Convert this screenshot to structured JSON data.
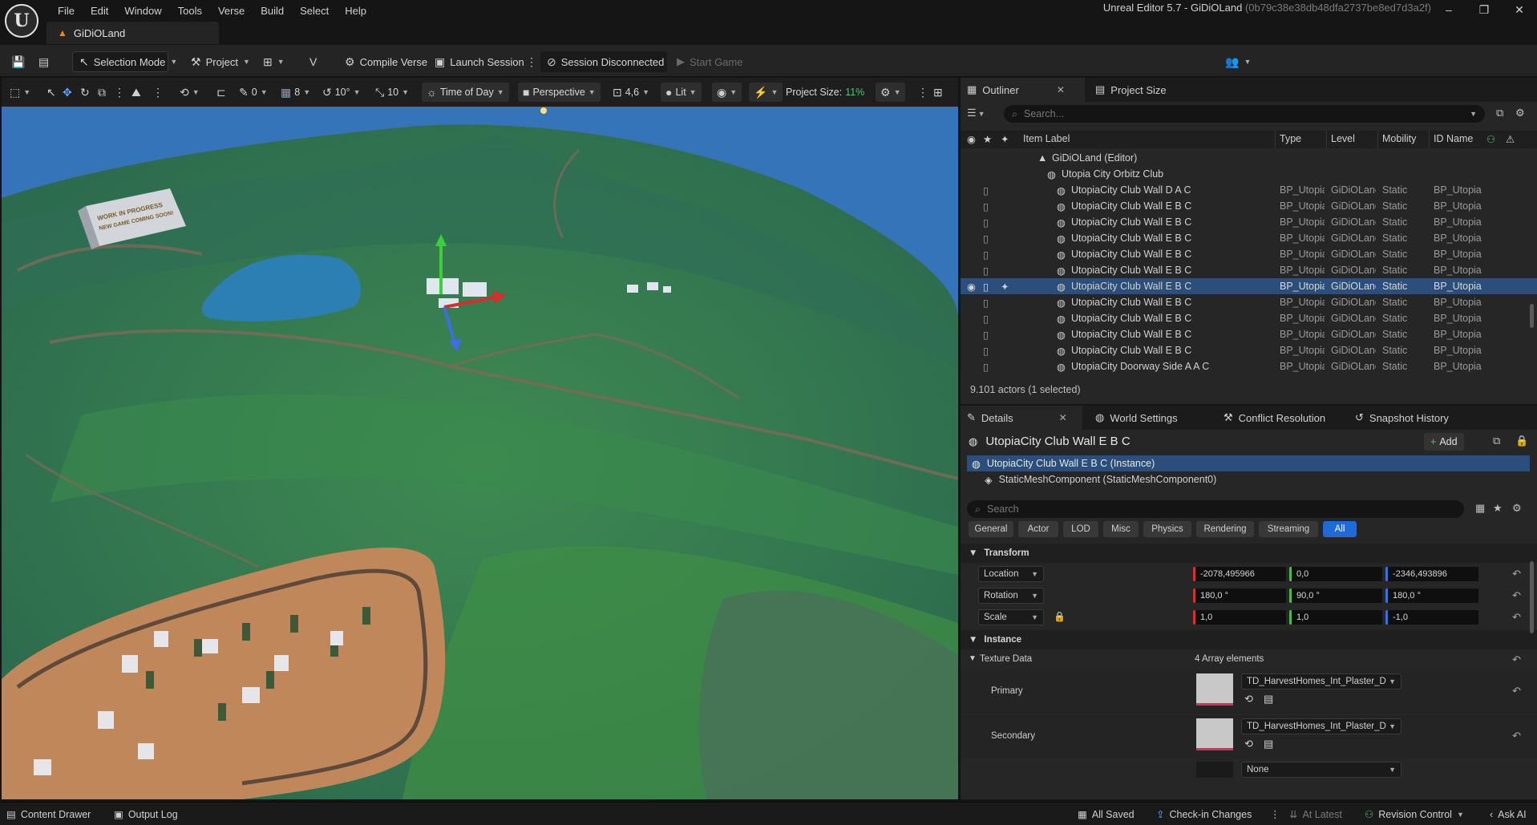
{
  "app": {
    "window_title": "Unreal Editor 5.7 - GiDiOLand",
    "window_hash": "(0b79c38e38db48dfa2737be8ed7d3a2f)",
    "project_tab": "GiDiOLand",
    "logo_glyph": "U",
    "window_controls": [
      "–",
      "❐",
      "✕"
    ]
  },
  "menu": [
    "File",
    "Edit",
    "Window",
    "Tools",
    "Verse",
    "Build",
    "Select",
    "Help"
  ],
  "toolbar": {
    "selection_mode": "Selection Mode",
    "project": "Project",
    "compile_verse": "Compile Verse",
    "launch_session": "Launch Session",
    "session_status": "Session Disconnected",
    "start_game": "Start Game"
  },
  "viewport_toolbar": {
    "rotation_snap_translate": "0",
    "grid_snap": "8",
    "rotation_snap": "10°",
    "scale_snap": "10",
    "time_of_day": "Time of Day",
    "perspective": "Perspective",
    "camera_speed": "4,6",
    "view_mode": "Lit",
    "project_size_label": "Project Size:",
    "project_size_value": "11%"
  },
  "viewport": {
    "sign_line1": "WORK IN PROGRESS",
    "sign_line2": "NEW GAME COMING SOON!"
  },
  "outliner": {
    "tab_outliner": "Outliner",
    "tab_project_size": "Project Size",
    "search_placeholder": "Search...",
    "columns": [
      "Item Label",
      "Type",
      "Level",
      "Mobility",
      "ID Name"
    ],
    "root": "GiDiOLand (Editor)",
    "folder": "Utopia City Orbitz Club",
    "rows": [
      {
        "label": "UtopiaCity Club Wall D A C",
        "type": "BP_Utopia",
        "level": "GiDiOLand",
        "mobility": "Static",
        "id": "BP_Utopia",
        "selected": false
      },
      {
        "label": "UtopiaCity Club Wall E B C",
        "type": "BP_Utopia",
        "level": "GiDiOLand",
        "mobility": "Static",
        "id": "BP_Utopia",
        "selected": false
      },
      {
        "label": "UtopiaCity Club Wall E B C",
        "type": "BP_Utopia",
        "level": "GiDiOLand",
        "mobility": "Static",
        "id": "BP_Utopia",
        "selected": false
      },
      {
        "label": "UtopiaCity Club Wall E B C",
        "type": "BP_Utopia",
        "level": "GiDiOLand",
        "mobility": "Static",
        "id": "BP_Utopia",
        "selected": false
      },
      {
        "label": "UtopiaCity Club Wall E B C",
        "type": "BP_Utopia",
        "level": "GiDiOLand",
        "mobility": "Static",
        "id": "BP_Utopia",
        "selected": false
      },
      {
        "label": "UtopiaCity Club Wall E B C",
        "type": "BP_Utopia",
        "level": "GiDiOLand",
        "mobility": "Static",
        "id": "BP_Utopia",
        "selected": false
      },
      {
        "label": "UtopiaCity Club Wall E B C",
        "type": "BP_Utopia",
        "level": "GiDiOLand",
        "mobility": "Static",
        "id": "BP_Utopia",
        "selected": true
      },
      {
        "label": "UtopiaCity Club Wall E B C",
        "type": "BP_Utopia",
        "level": "GiDiOLand",
        "mobility": "Static",
        "id": "BP_Utopia",
        "selected": false
      },
      {
        "label": "UtopiaCity Club Wall E B C",
        "type": "BP_Utopia",
        "level": "GiDiOLand",
        "mobility": "Static",
        "id": "BP_Utopia",
        "selected": false
      },
      {
        "label": "UtopiaCity Club Wall E B C",
        "type": "BP_Utopia",
        "level": "GiDiOLand",
        "mobility": "Static",
        "id": "BP_Utopia",
        "selected": false
      },
      {
        "label": "UtopiaCity Club Wall E B C",
        "type": "BP_Utopia",
        "level": "GiDiOLand",
        "mobility": "Static",
        "id": "BP_Utopia",
        "selected": false
      },
      {
        "label": "UtopiaCity Doorway Side A A C",
        "type": "BP_Utopia",
        "level": "GiDiOLand",
        "mobility": "Static",
        "id": "BP_Utopia",
        "selected": false
      }
    ],
    "actor_count": "9.101 actors (1 selected)"
  },
  "details": {
    "tabs": [
      "Details",
      "World Settings",
      "Conflict Resolution",
      "Snapshot History"
    ],
    "actor_name": "UtopiaCity Club Wall E B C",
    "add_label": "Add",
    "instance_row": "UtopiaCity Club Wall E B C (Instance)",
    "component_row": "StaticMeshComponent (StaticMeshComponent0)",
    "search_placeholder": "Search",
    "filters": [
      "General",
      "Actor",
      "LOD",
      "Misc",
      "Physics",
      "Rendering",
      "Streaming",
      "All"
    ],
    "transform_section": "Transform",
    "location_label": "Location",
    "location": [
      "-2078,495966",
      "0,0",
      "-2346,493896"
    ],
    "rotation_label": "Rotation",
    "rotation": [
      "180,0 °",
      "90,0 °",
      "180,0 °"
    ],
    "scale_label": "Scale",
    "scale": [
      "1,0",
      "1,0",
      "-1,0"
    ],
    "instance_section": "Instance",
    "texture_data_label": "Texture Data",
    "texture_data_count": "4 Array elements",
    "primary_label": "Primary",
    "primary_value": "TD_HarvestHomes_Int_Plaster_D",
    "secondary_label": "Secondary",
    "secondary_value": "TD_HarvestHomes_Int_Plaster_D",
    "third_value": "None"
  },
  "statusbar": {
    "content_drawer": "Content Drawer",
    "output_log": "Output Log",
    "all_saved": "All Saved",
    "checkin": "Check-in Changes",
    "at_latest": "At Latest",
    "revision_control": "Revision Control",
    "ask_ai": "Ask AI"
  },
  "colors": {
    "selection_blue": "#2b4e7c",
    "accent_blue": "#1f6ad9",
    "ok_green": "#4cc860",
    "x_red": "#d63030",
    "y_green": "#4fb84f",
    "z_blue": "#3b72d9"
  },
  "icons": [
    "unreal-logo-icon",
    "save-icon",
    "history-icon",
    "cursor-icon",
    "move-icon",
    "rotate-icon",
    "scale-icon",
    "grid-icon",
    "eye-icon",
    "pin-icon",
    "gear-icon",
    "close-icon",
    "search-icon",
    "lock-icon",
    "star-icon",
    "plus-icon",
    "reset-arrow-icon"
  ]
}
